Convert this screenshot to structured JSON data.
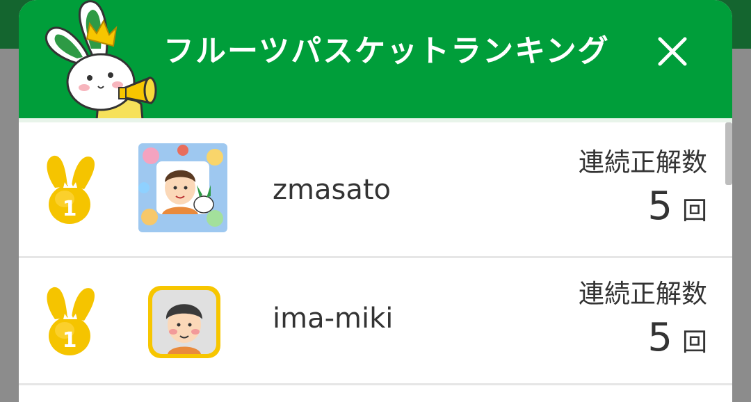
{
  "header": {
    "title": "フルーツパスケットランキング",
    "close_icon": "close-icon",
    "mascot_icon": "rabbit-mascot-megaphone-icon",
    "mascot_text": "",
    "bg_color": "#009e3a"
  },
  "ranking": [
    {
      "rank": "1",
      "medal_icon": "gold-rabbit-medal-icon",
      "avatar_icon": "avatar-collage-icon",
      "name": "zmasato",
      "stat_label": "連続正解数",
      "value": "5",
      "unit": "回"
    },
    {
      "rank": "1",
      "medal_icon": "gold-rabbit-medal-icon",
      "avatar_icon": "avatar-man-icon",
      "name": "ima-miki",
      "stat_label": "連続正解数",
      "value": "5",
      "unit": "回"
    }
  ],
  "colors": {
    "header": "#009e3a",
    "medal": "#f2c200",
    "avatar_border": "#f7c600"
  }
}
